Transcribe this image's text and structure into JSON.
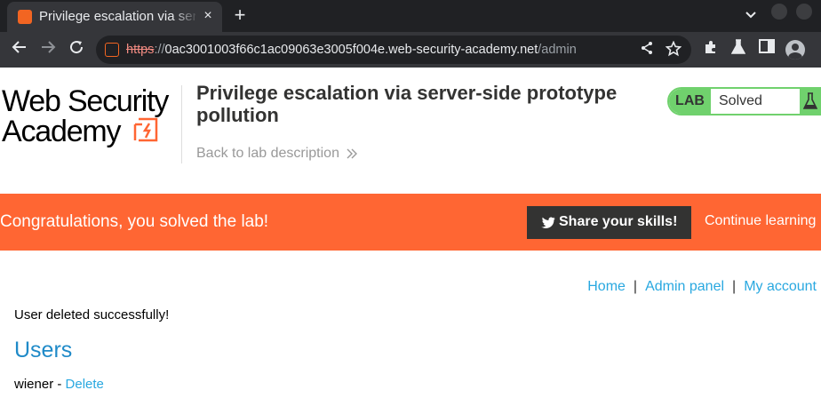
{
  "browser": {
    "tab_title": "Privilege escalation via server-side prototype pollution",
    "tab_close": "×",
    "new_tab": "+",
    "url": {
      "scheme": "https",
      "separator": "://",
      "host": "0ac3001003f66c1ac09063e3005f004e.web-security-academy.net",
      "path": "/admin"
    },
    "icons": [
      "back-arrow-icon",
      "forward-arrow-icon",
      "reload-icon",
      "share-icon",
      "star-icon",
      "extensions-icon",
      "labs-flask-icon",
      "sidebar-icon",
      "profile-icon"
    ]
  },
  "header": {
    "logo": {
      "line1": "Web Security",
      "line2": "Academy"
    },
    "lab_title": "Privilege escalation via server-side prototype pollution",
    "back_link": "Back to lab description",
    "lab_status": {
      "badge": "LAB",
      "status": "Solved"
    }
  },
  "banner": {
    "message": "Congratulations, you solved the lab!",
    "share_button": "Share your skills!",
    "continue_link": "Continue learning"
  },
  "nav": {
    "home": "Home",
    "separator": "|",
    "admin_panel": "Admin panel",
    "my_account": "My account"
  },
  "content": {
    "message": "User deleted successfully!",
    "users_heading": "Users",
    "users": [
      {
        "username": "wiener",
        "separator": " - ",
        "action": "Delete"
      }
    ]
  },
  "colors": {
    "brand_orange": "#ff6633",
    "status_green": "#70d16d",
    "link_blue": "#29a8e0",
    "heading_blue": "#1f8ac8"
  }
}
